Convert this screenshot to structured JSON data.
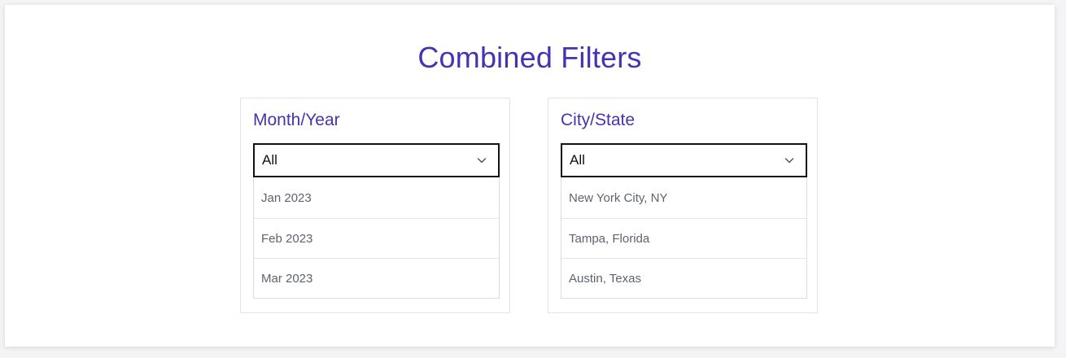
{
  "page": {
    "title": "Combined Filters"
  },
  "filters": [
    {
      "label": "Month/Year",
      "selected": "All",
      "options": [
        "Jan 2023",
        "Feb 2023",
        "Mar 2023"
      ]
    },
    {
      "label": "City/State",
      "selected": "All",
      "options": [
        "New York City, NY",
        "Tampa, Florida",
        "Austin, Texas"
      ]
    }
  ],
  "colors": {
    "accent": "#4633b1",
    "option_text": "#5f6370",
    "select_border": "#111111"
  },
  "icons": {
    "dropdown": "chevron-down-icon"
  }
}
